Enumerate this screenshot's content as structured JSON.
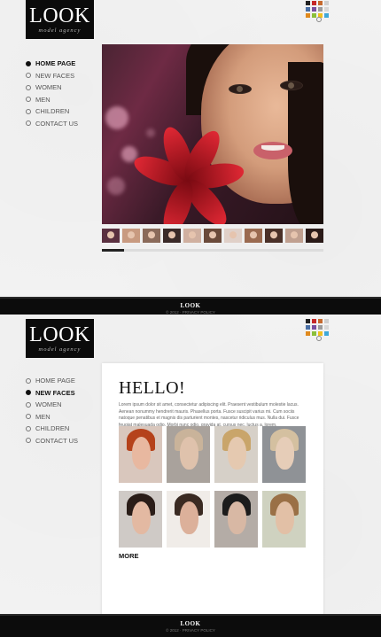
{
  "brand": {
    "name": "LOOK",
    "tagline": "model agency"
  },
  "swatch_colors": [
    "#222222",
    "#c62828",
    "#c66a2e",
    "#cfcfcf",
    "#4a6fa5",
    "#7a4f9e",
    "#9c9c9c",
    "#d8d8d8",
    "#e08a1e",
    "#8bbf3a",
    "#f0c020",
    "#3fa8d8"
  ],
  "nav": {
    "items": [
      "HOME PAGE",
      "NEW FACES",
      "WOMEN",
      "MEN",
      "CHILDREN",
      "CONTACT US"
    ],
    "page1_active": "HOME PAGE",
    "page2_active": "NEW FACES"
  },
  "thumb_colors": [
    "#5a3040",
    "#c89a80",
    "#8a6a5a",
    "#3a2a28",
    "#d0b0a0",
    "#6a4a3a",
    "#e0d0c8",
    "#9a6a50",
    "#4a3028",
    "#c0a090",
    "#2a1a18",
    "#b08070"
  ],
  "slider_progress": 0.1,
  "footer": {
    "title": "LOOK",
    "copyright": "© 2012 · PRIVACY POLICY"
  },
  "hello": {
    "heading": "HELLO!",
    "text": "Lorem ipsum dolor sit amet, consectetur adipiscing elit. Praesent vestibulum molestie lacus. Aenean nonummy hendrerit mauris. Phasellus porta. Fusce suscipit varius mi. Cum sociis natoque penatibus et magnis dis parturient montes, nascetur ridiculus mus. Nulla dui. Fusce feugiat malesuada odio. Morbi nunc odio, gravida at, cursus nec, luctus a, lorem.",
    "more_label": "MORE"
  },
  "gallery_photos": [
    {
      "bg": "#d9c7bd",
      "hair": "#b5421b",
      "skin": "#e8b8a0"
    },
    {
      "bg": "#a9a29c",
      "hair": "#c9b39a",
      "skin": "#dfc2ac"
    },
    {
      "bg": "#d6d0c8",
      "hair": "#c9a56a",
      "skin": "#e5c9b0"
    },
    {
      "bg": "#8f9296",
      "hair": "#d4c0a0",
      "skin": "#e6cdb8"
    },
    {
      "bg": "#cfcac6",
      "hair": "#2a1d18",
      "skin": "#e3b9a2"
    },
    {
      "bg": "#f0ece8",
      "hair": "#3a2a22",
      "skin": "#dcb09a"
    },
    {
      "bg": "#b4aca6",
      "hair": "#1c1c1c",
      "skin": "#d8b8a4"
    },
    {
      "bg": "#cfd2c0",
      "hair": "#9a7046",
      "skin": "#e2c0a6"
    }
  ]
}
